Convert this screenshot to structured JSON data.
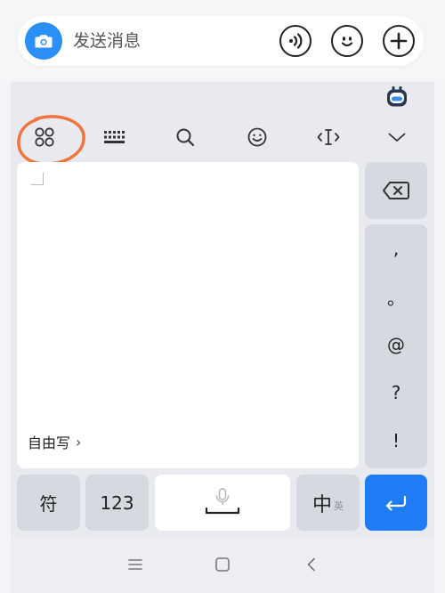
{
  "chat_bar": {
    "message_placeholder": "发送消息",
    "icons": {
      "camera": "camera-icon",
      "voice": "voice-waves-icon",
      "emoji": "emoji-icon",
      "add": "plus-icon"
    }
  },
  "keyboard": {
    "toolbar": {
      "icons": [
        "apps-grid-icon",
        "keyboard-layout-icon",
        "search-icon",
        "emoji-icon",
        "cursor-move-icon",
        "collapse-chevron-icon"
      ],
      "annotation_color": "#f0743e"
    },
    "handwriting_pad": {
      "freewrite_label": "自由写",
      "chevron": "›"
    },
    "punctuation": [
      ",",
      "。",
      "@",
      "?",
      "!"
    ],
    "bottom_row": {
      "symbols_label": "符",
      "numbers_label": "123",
      "lang_main": "中",
      "lang_sub": "英"
    },
    "navigation": {
      "icons": [
        "menu-icon",
        "home-square-icon",
        "back-chevron-icon"
      ]
    }
  },
  "colors": {
    "accent": "#1f7cf5",
    "camera": "#2a8ff7"
  }
}
